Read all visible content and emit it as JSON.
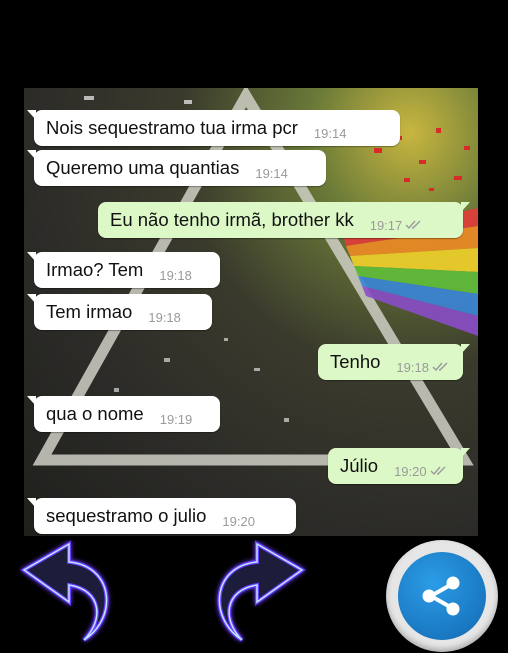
{
  "messages": [
    {
      "side": "in",
      "text": "Nois sequestramo tua irma pcr",
      "time": "19:14"
    },
    {
      "side": "in",
      "text": "Queremo uma quantias",
      "time": "19:14"
    },
    {
      "side": "out",
      "text": "Eu não tenho irmã, brother kk",
      "time": "19:17"
    },
    {
      "side": "in",
      "text": "Irmao? Tem",
      "time": "19:18"
    },
    {
      "side": "in",
      "text": "Tem irmao",
      "time": "19:18"
    },
    {
      "side": "out",
      "text": "Tenho",
      "time": "19:18"
    },
    {
      "side": "in",
      "text": "qua o nome",
      "time": "19:19"
    },
    {
      "side": "out",
      "text": "Júlio",
      "time": "19:20"
    },
    {
      "side": "in",
      "text": "sequestramo o julio",
      "time": "19:20"
    }
  ],
  "controls": {
    "previous": "previous-arrow-icon",
    "next": "next-arrow-icon",
    "share": "share-icon"
  },
  "colors": {
    "incoming_bubble": "#ffffff",
    "outgoing_bubble": "#dcf8c6",
    "share_button": "#1a78c2",
    "arrow_glow": "#7b3cff"
  }
}
